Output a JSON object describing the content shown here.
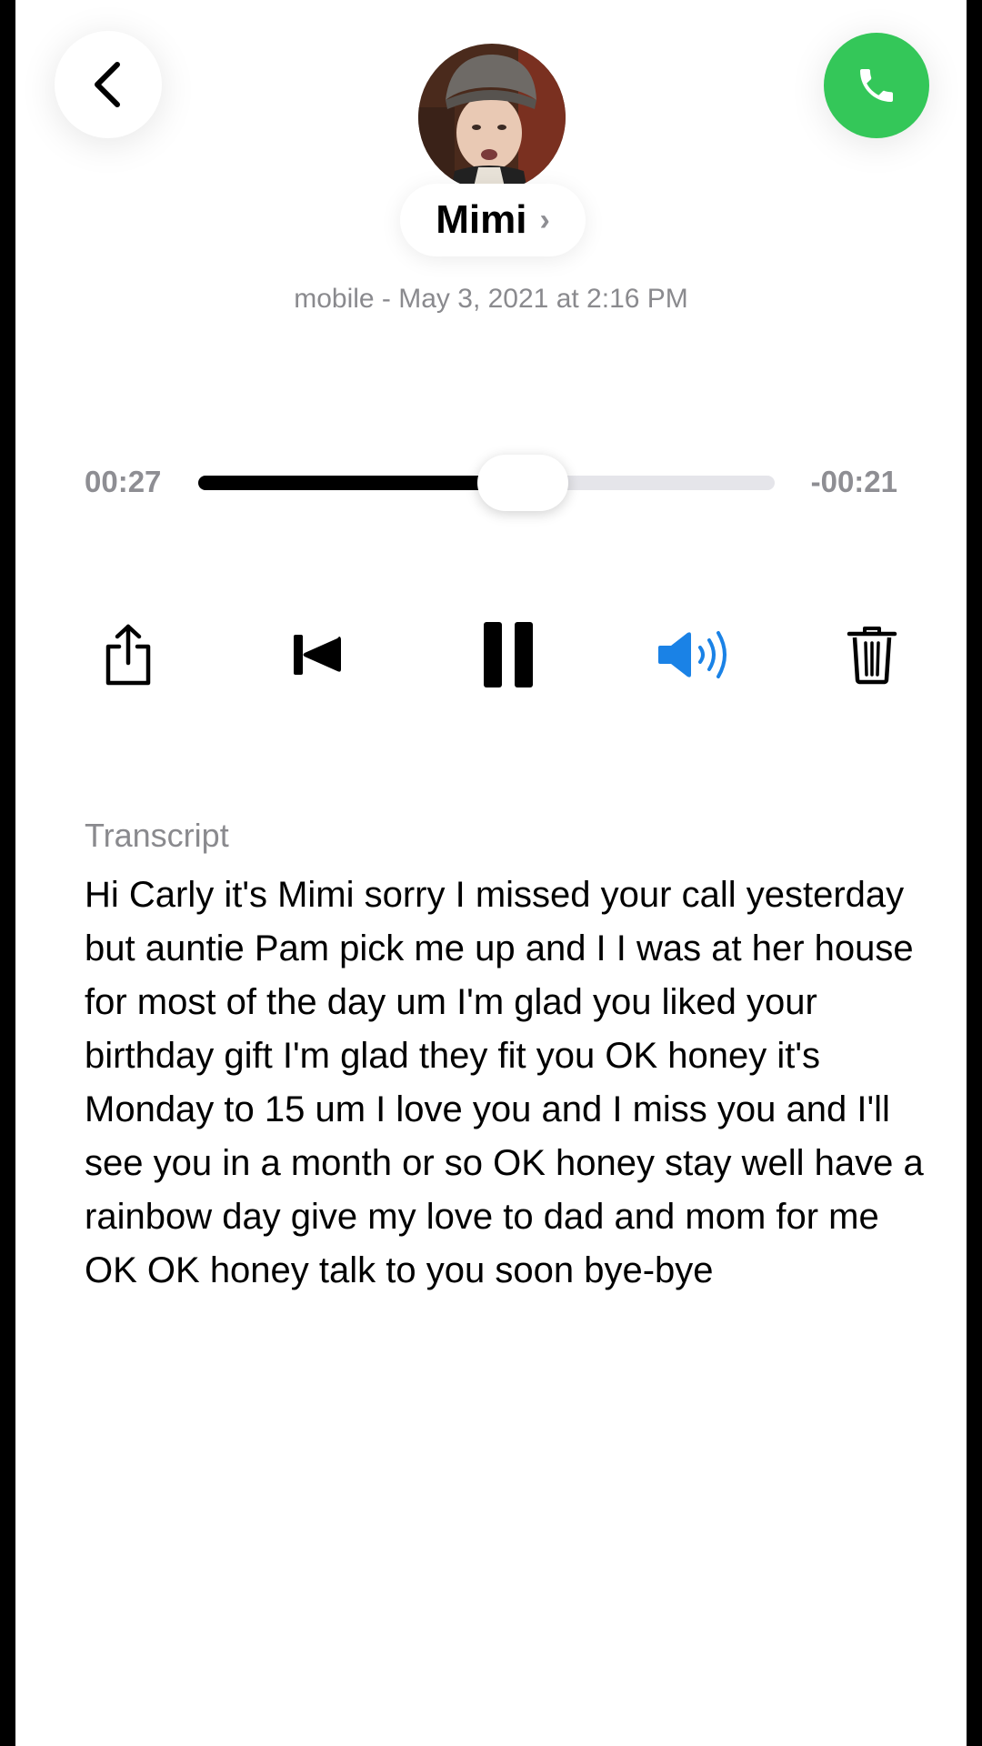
{
  "header": {
    "contact_name": "Mimi",
    "chevron": "›",
    "subtitle": "mobile - May 3, 2021 at 2:16 PM",
    "back_icon": "chevron-left-icon",
    "call_icon": "phone-icon"
  },
  "player": {
    "elapsed": "00:27",
    "remaining": "-00:21",
    "progress": 0.5625
  },
  "controls": [
    {
      "name": "share",
      "icon": "share-icon"
    },
    {
      "name": "rewind",
      "icon": "skip-back-icon"
    },
    {
      "name": "pause",
      "icon": "pause-icon"
    },
    {
      "name": "speaker",
      "icon": "speaker-icon"
    },
    {
      "name": "delete",
      "icon": "trash-icon"
    }
  ],
  "transcript": {
    "label": "Transcript",
    "text": "Hi Carly it's Mimi sorry I missed your call yesterday but auntie Pam pick me up and I I was at her house for most of the day um I'm glad you liked your birthday gift I'm glad they fit you OK honey it's Monday to 15 um I love you and I miss you and I'll see you in a month or so OK honey stay well have a rainbow day give my love to dad and mom for me OK OK honey talk to you soon bye-bye"
  },
  "colors": {
    "call_green": "#34c759",
    "speaker_blue": "#1a82e6",
    "secondary_text": "#8a8a8e"
  }
}
